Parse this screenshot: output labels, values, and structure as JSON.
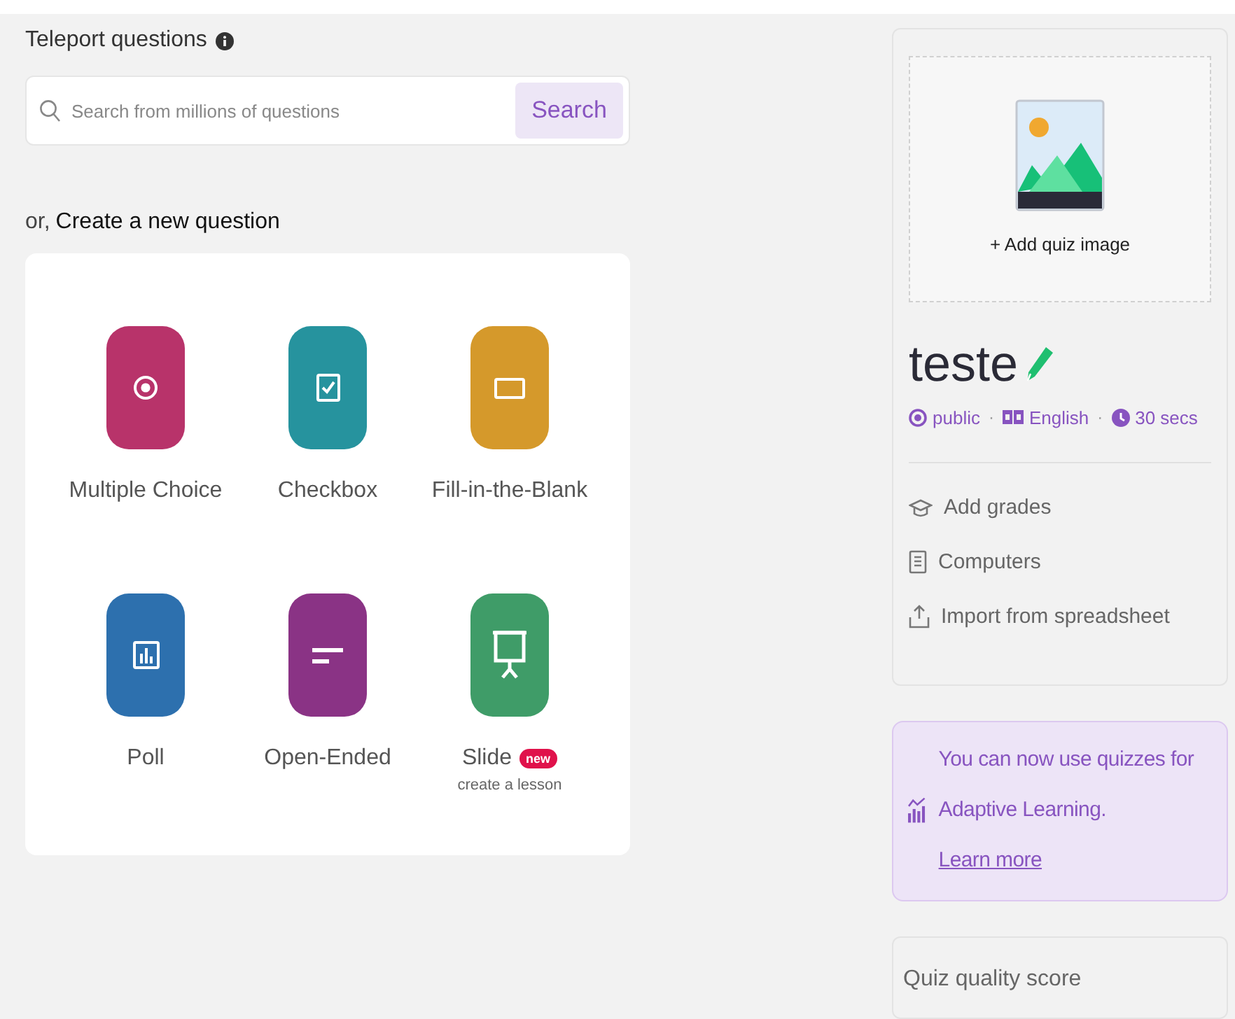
{
  "teleport": {
    "title": "Teleport questions",
    "search": {
      "placeholder": "Search from millions of questions",
      "button": "Search"
    }
  },
  "create": {
    "prefix": "or,",
    "title": "Create a new question",
    "types": [
      {
        "kind": "radio",
        "label": "Multiple Choice",
        "color": "#b8336a"
      },
      {
        "kind": "checkbox",
        "label": "Checkbox",
        "color": "#26939e"
      },
      {
        "kind": "blank",
        "label": "Fill-in-the-Blank",
        "color": "#d5992b"
      },
      {
        "kind": "poll",
        "label": "Poll",
        "color": "#2d70ae"
      },
      {
        "kind": "open",
        "label": "Open-Ended",
        "color": "#8a3385"
      },
      {
        "kind": "slide",
        "label": "Slide",
        "color": "#3f9c68",
        "badge": "new",
        "sublabel": "create a lesson"
      }
    ]
  },
  "quiz": {
    "image_label": "+ Add quiz image",
    "title": "teste",
    "meta": [
      {
        "kind": "visibility",
        "text": "public"
      },
      {
        "kind": "language",
        "separator": "·",
        "text": "English"
      },
      {
        "kind": "time",
        "separator": "·",
        "text": "30 secs"
      }
    ],
    "details": [
      {
        "kind": "grades",
        "text": "Add grades"
      },
      {
        "kind": "subject",
        "text": "Computers"
      },
      {
        "kind": "import",
        "text": "Import from spreadsheet"
      }
    ]
  },
  "promo": {
    "text": "You can now use quizzes for Adaptive Learning.",
    "link": "Learn more"
  },
  "quality": {
    "title": "Quiz quality score"
  }
}
